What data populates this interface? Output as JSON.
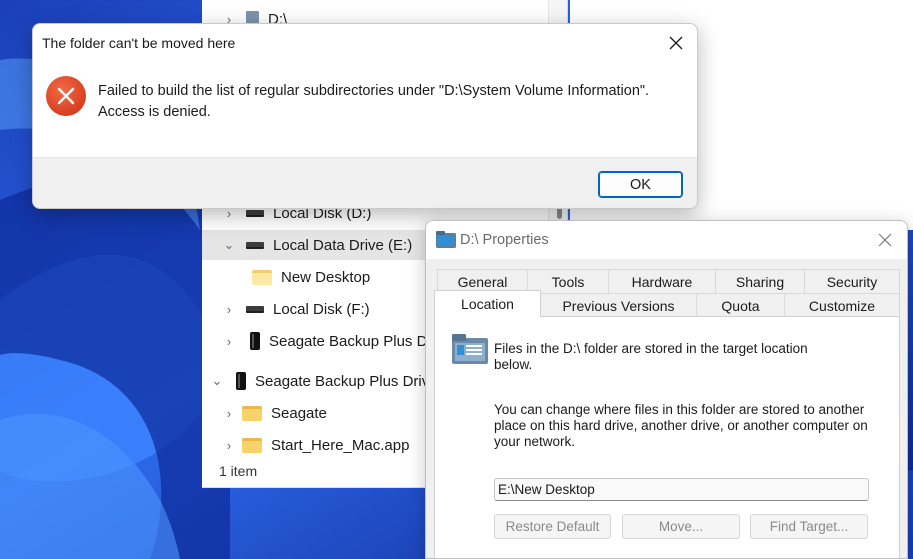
{
  "colors": {
    "accent": "#0067c0",
    "error_red": "#e0492b",
    "wallpaper_blue": "#1f55d6"
  },
  "explorer": {
    "tree": [
      {
        "label": "D:\\",
        "chevron": "›",
        "icon": "disk-doc-icon",
        "selected": false
      },
      {
        "label": "Local Disk (D:)",
        "chevron": "›",
        "icon": "drive-icon",
        "selected": false
      },
      {
        "label": "Local Data Drive (E:)",
        "chevron": "⌄",
        "icon": "drive-icon",
        "selected": true
      },
      {
        "label": "New Desktop",
        "chevron": "",
        "icon": "folder-icon",
        "selected": false
      },
      {
        "label": "Local Disk (F:)",
        "chevron": "›",
        "icon": "drive-icon",
        "selected": false
      },
      {
        "label": "Seagate Backup Plus Drive",
        "chevron": "›",
        "icon": "external-drive-icon",
        "selected": false
      },
      {
        "label": "Seagate Backup Plus Drive",
        "chevron": "⌄",
        "icon": "external-drive-icon",
        "selected": false
      },
      {
        "label": "Seagate",
        "chevron": "›",
        "icon": "folder-icon",
        "selected": false
      },
      {
        "label": "Start_Here_Mac.app",
        "chevron": "›",
        "icon": "folder-icon",
        "selected": false
      }
    ],
    "status": "1 item"
  },
  "error_dialog": {
    "title": "The folder can't be moved here",
    "message": "Failed to build the list of regular subdirectories under \"D:\\System Volume Information\". Access is denied.",
    "ok_label": "OK",
    "icon": "error-icon"
  },
  "properties": {
    "title": "D:\\ Properties",
    "tabs_row1": [
      "General",
      "Tools",
      "Hardware",
      "Sharing",
      "Security"
    ],
    "tabs_row2": [
      "Location",
      "Previous Versions",
      "Quota",
      "Customize"
    ],
    "active_tab": "Location",
    "info_text": "Files in the D:\\ folder are stored in the target location below.",
    "help_text": "You can change where files in this folder are stored to another place on this hard drive, another drive, or another computer on your network.",
    "target_value": "E:\\New Desktop",
    "buttons": {
      "restore_default": "Restore Default",
      "move": "Move...",
      "find_target": "Find Target..."
    }
  }
}
